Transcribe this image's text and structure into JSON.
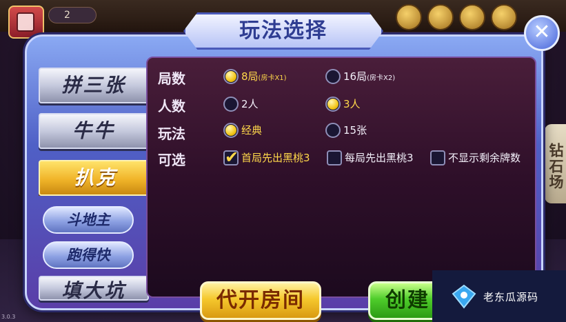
{
  "topbar": {
    "coins": "2"
  },
  "dialog": {
    "title": "玩法选择",
    "close_icon": "close-icon",
    "categories": [
      {
        "label": "拼三张",
        "active": false
      },
      {
        "label": "牛牛",
        "active": false
      },
      {
        "label": "扒克",
        "active": true
      }
    ],
    "sub_categories": [
      {
        "label": "斗地主"
      },
      {
        "label": "跑得快"
      }
    ],
    "partial_category": "填大坑",
    "options": {
      "rounds": {
        "label": "局数",
        "choices": [
          {
            "text": "8局",
            "note": "(房卡X1)",
            "selected": true
          },
          {
            "text": "16局",
            "note": "(房卡X2)",
            "selected": false
          }
        ]
      },
      "players": {
        "label": "人数",
        "choices": [
          {
            "text": "2人",
            "selected": false
          },
          {
            "text": "3人",
            "selected": true
          }
        ]
      },
      "mode": {
        "label": "玩法",
        "choices": [
          {
            "text": "经典",
            "selected": true
          },
          {
            "text": "15张",
            "selected": false
          }
        ]
      },
      "optional": {
        "label": "可选",
        "choices": [
          {
            "text": "首局先出黑桃3",
            "checked": true
          },
          {
            "text": "每局先出黑桃3",
            "checked": false
          },
          {
            "text": "不显示剩余牌数",
            "checked": false
          }
        ]
      }
    },
    "buttons": {
      "open_for_others": "代开房间",
      "create": "创建"
    }
  },
  "side_tab": "钻石场",
  "version": "3.0.3",
  "watermark": "老东瓜源码",
  "colors": {
    "accent_gold": "#f3c619",
    "dialog_blue": "#4f60c6",
    "panel_dark": "#2e0f29",
    "green_button": "#4fcd2b"
  }
}
